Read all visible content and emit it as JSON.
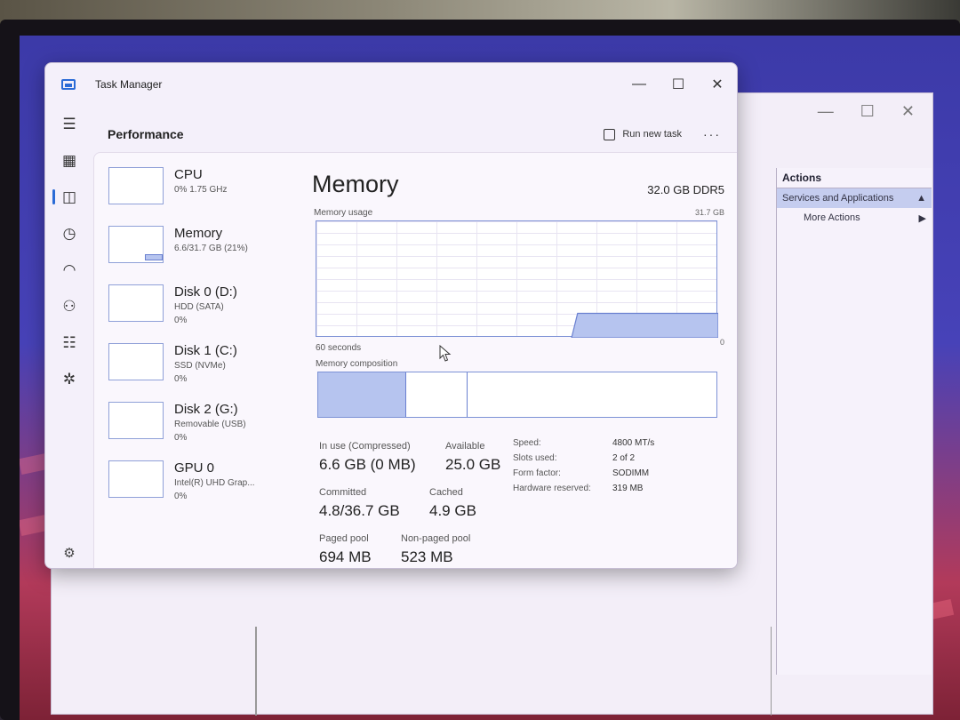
{
  "window": {
    "title": "Task Manager",
    "controls": {
      "minimize": "—",
      "maximize": "☐",
      "close": "✕"
    }
  },
  "header": {
    "page_title": "Performance",
    "run_new_task": "Run new task",
    "more": "···"
  },
  "nav_icons": [
    "hamburger-icon",
    "processes-icon",
    "performance-icon",
    "app-history-icon",
    "startup-apps-icon",
    "users-icon",
    "details-icon",
    "services-icon",
    "settings-icon"
  ],
  "resources": [
    {
      "name": "CPU",
      "sub1": "0% 1.75 GHz",
      "sub2": "",
      "sub3": ""
    },
    {
      "name": "Memory",
      "sub1": "6.6/31.7 GB (21%)",
      "sub2": "",
      "sub3": ""
    },
    {
      "name": "Disk 0 (D:)",
      "sub1": "HDD (SATA)",
      "sub2": "0%",
      "sub3": ""
    },
    {
      "name": "Disk 1 (C:)",
      "sub1": "SSD (NVMe)",
      "sub2": "0%",
      "sub3": ""
    },
    {
      "name": "Disk 2 (G:)",
      "sub1": "Removable (USB)",
      "sub2": "0%",
      "sub3": ""
    },
    {
      "name": "GPU 0",
      "sub1": "Intel(R) UHD Grap...",
      "sub2": "0%",
      "sub3": ""
    }
  ],
  "detail": {
    "title": "Memory",
    "spec": "32.0 GB DDR5",
    "usage_label": "Memory usage",
    "usage_max": "31.7 GB",
    "axis_left": "60 seconds",
    "axis_right": "0",
    "composition_label": "Memory composition",
    "composition": {
      "in_use_frac": 0.22,
      "modified_frac": 0.155,
      "standby_frac": 0.625
    },
    "usage_level_frac": 0.21
  },
  "stats": {
    "in_use_label": "In use (Compressed)",
    "in_use_value": "6.6 GB (0 MB)",
    "available_label": "Available",
    "available_value": "25.0 GB",
    "committed_label": "Committed",
    "committed_value": "4.8/36.7 GB",
    "cached_label": "Cached",
    "cached_value": "4.9 GB",
    "paged_label": "Paged pool",
    "paged_value": "694 MB",
    "nonpaged_label": "Non-paged pool",
    "nonpaged_value": "523 MB"
  },
  "specs": [
    {
      "key": "Speed:",
      "value": "4800 MT/s"
    },
    {
      "key": "Slots used:",
      "value": "2 of 2"
    },
    {
      "key": "Form factor:",
      "value": "SODIMM"
    },
    {
      "key": "Hardware reserved:",
      "value": "319 MB"
    }
  ],
  "background_window": {
    "actions_title": "Actions",
    "services_label": "Services and Applications",
    "more_actions": "More Actions"
  },
  "colors": {
    "accent": "#2a6bd6",
    "graph_fill": "#b6c4ef",
    "graph_stroke": "#6a80d0"
  }
}
